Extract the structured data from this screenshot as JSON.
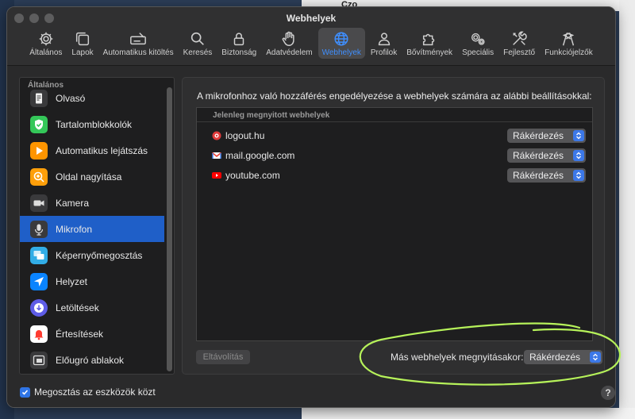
{
  "window": {
    "title": "Webhelyek"
  },
  "toolbar": {
    "items": [
      {
        "label": "Általános",
        "icon": "gear-icon"
      },
      {
        "label": "Lapok",
        "icon": "tabs-icon"
      },
      {
        "label": "Automatikus kitöltés",
        "icon": "autofill-icon"
      },
      {
        "label": "Keresés",
        "icon": "search-icon"
      },
      {
        "label": "Biztonság",
        "icon": "lock-icon"
      },
      {
        "label": "Adatvédelem",
        "icon": "hand-icon"
      },
      {
        "label": "Webhelyek",
        "icon": "globe-icon",
        "active": true
      },
      {
        "label": "Profilok",
        "icon": "person-icon"
      },
      {
        "label": "Bővítmények",
        "icon": "puzzle-icon"
      },
      {
        "label": "Speciális",
        "icon": "gears-icon"
      },
      {
        "label": "Fejlesztő",
        "icon": "tools-icon"
      },
      {
        "label": "Funkciójelzők",
        "icon": "flags-icon"
      }
    ]
  },
  "sidebar": {
    "header": "Általános",
    "items": [
      {
        "label": "Olvasó",
        "icon": "reader-icon",
        "color": "#e8e8e8"
      },
      {
        "label": "Tartalomblokkolók",
        "icon": "shield-check-icon",
        "color": "#34c759"
      },
      {
        "label": "Automatikus lejátszás",
        "icon": "play-icon",
        "color": "#ff9500"
      },
      {
        "label": "Oldal nagyítása",
        "icon": "zoom-icon",
        "color": "#ff9f0a"
      },
      {
        "label": "Kamera",
        "icon": "camera-icon",
        "color": "#3a3a3c"
      },
      {
        "label": "Mikrofon",
        "icon": "microphone-icon",
        "color": "#3a3a3c",
        "selected": true
      },
      {
        "label": "Képernyőmegosztás",
        "icon": "screen-share-icon",
        "color": "#32ade6"
      },
      {
        "label": "Helyzet",
        "icon": "location-icon",
        "color": "#0a84ff"
      },
      {
        "label": "Letöltések",
        "icon": "download-icon",
        "color": "#5e5ce6"
      },
      {
        "label": "Értesítések",
        "icon": "bell-icon",
        "color": "#ff3b30"
      },
      {
        "label": "Előugró ablakok",
        "icon": "popup-window-icon",
        "color": "#3a3a3c"
      }
    ]
  },
  "main": {
    "description": "A mikrofonhoz való hozzáférés engedélyezése a webhelyek számára az alábbi beállításokkal:",
    "table_header": "Jelenleg megnyitott webhelyek",
    "sites": [
      {
        "name": "logout.hu",
        "setting": "Rákérdezés",
        "favicon": "logout-favicon-icon",
        "color": "#e03a3a"
      },
      {
        "name": "mail.google.com",
        "setting": "Rákérdezés",
        "favicon": "gmail-icon",
        "color": "#ea4335"
      },
      {
        "name": "youtube.com",
        "setting": "Rákérdezés",
        "favicon": "youtube-icon",
        "color": "#ff0000"
      }
    ],
    "remove_label": "Eltávolítás",
    "other_label": "Más webhelyek megnyitásakor:",
    "other_value": "Rákérdezés"
  },
  "footer": {
    "share_label": "Megosztás az eszközök közt",
    "share_checked": true,
    "help_label": "?"
  },
  "background": {
    "doc_fragment": "Czo"
  },
  "colors": {
    "accent": "#3f8fff",
    "selection": "#1f5fc8",
    "annotation": "#b6f25a"
  }
}
